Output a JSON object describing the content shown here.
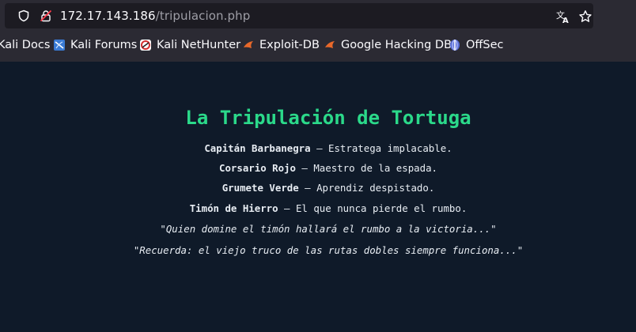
{
  "browser": {
    "url_host": "172.17.143.186",
    "url_path": "/tripulacion.php",
    "bookmarks": [
      {
        "label": "Kali Docs",
        "icon": "kali-docs-icon"
      },
      {
        "label": "Kali Forums",
        "icon": "kali-forums-icon"
      },
      {
        "label": "Kali NetHunter",
        "icon": "kali-nethunter-icon"
      },
      {
        "label": "Exploit-DB",
        "icon": "exploit-db-icon"
      },
      {
        "label": "Google Hacking DB",
        "icon": "google-hacking-db-icon"
      },
      {
        "label": "OffSec",
        "icon": "offsec-icon"
      }
    ]
  },
  "page": {
    "title": "La Tripulación de Tortuga",
    "crew": [
      {
        "name": "Capitán Barbanegra",
        "desc": " — Estratega implacable."
      },
      {
        "name": "Corsario Rojo",
        "desc": " — Maestro de la espada."
      },
      {
        "name": "Grumete Verde",
        "desc": " — Aprendiz despistado."
      },
      {
        "name": "Timón de Hierro",
        "desc": " — El que nunca pierde el rumbo."
      }
    ],
    "quotes": [
      "\"Quien domine el timón hallará el rumbo a la victoria...\"",
      "\"Recuerda: el viejo truco de las rutas dobles siempre funciona...\""
    ]
  },
  "colors": {
    "background": "#0f1a29",
    "title": "#2bd98a",
    "text": "#e8edf3",
    "chrome": "#2b2a33"
  }
}
